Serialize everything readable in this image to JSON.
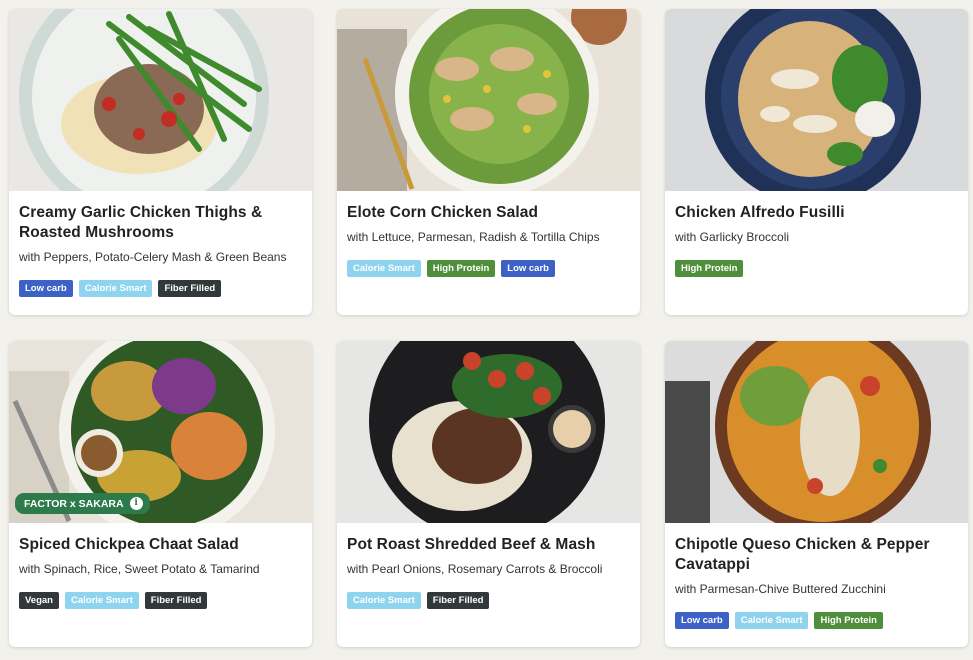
{
  "meals": [
    {
      "title": "Creamy Garlic Chicken Thighs & Roasted Mushrooms",
      "subtitle": "with Peppers, Potato-Celery Mash & Green Beans",
      "badges": [
        "Low carb",
        "Calorie Smart",
        "Fiber Filled"
      ]
    },
    {
      "title": "Elote Corn Chicken Salad",
      "subtitle": "with Lettuce, Parmesan, Radish & Tortilla Chips",
      "badges": [
        "Calorie Smart",
        "High Protein",
        "Low carb"
      ]
    },
    {
      "title": "Chicken Alfredo Fusilli",
      "subtitle": "with Garlicky Broccoli",
      "badges": [
        "High Protein"
      ]
    },
    {
      "title": "Spiced Chickpea Chaat Salad",
      "subtitle": "with Spinach, Rice, Sweet Potato & Tamarind",
      "badges": [
        "Vegan",
        "Calorie Smart",
        "Fiber Filled"
      ],
      "partner_label": "FACTOR x SAKARA",
      "partner_info_icon": "i"
    },
    {
      "title": "Pot Roast Shredded Beef & Mash",
      "subtitle": "with Pearl Onions, Rosemary Carrots & Broccoli",
      "badges": [
        "Calorie Smart",
        "Fiber Filled"
      ]
    },
    {
      "title": "Chipotle Queso Chicken & Pepper Cavatappi",
      "subtitle": "with Parmesan-Chive Buttered Zucchini",
      "badges": [
        "Low carb",
        "Calorie Smart",
        "High Protein"
      ]
    }
  ],
  "badge_colors": {
    "Low carb": "#3d61c4",
    "Calorie Smart": "#8fd4ef",
    "Fiber Filled": "#33393b",
    "High Protein": "#4f8f3c",
    "Vegan": "#33393b"
  },
  "icons": {
    "partner_info": "info-icon"
  }
}
